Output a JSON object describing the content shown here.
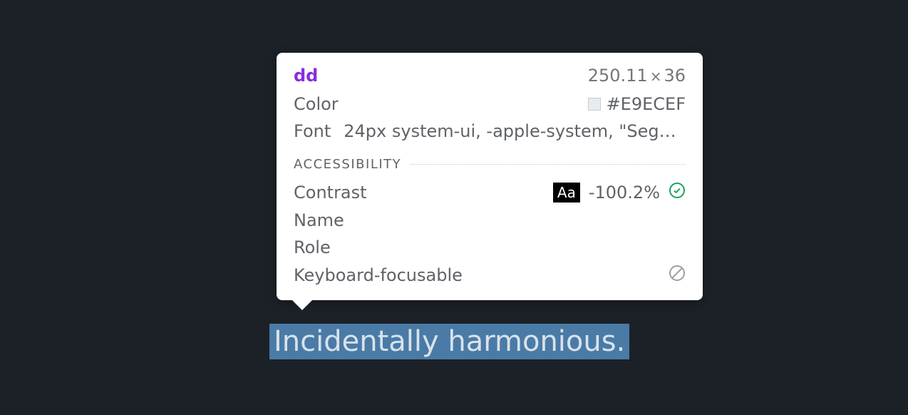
{
  "inspector": {
    "element_tag": "dd",
    "dimensions": {
      "width": "250.11",
      "height": "36"
    },
    "properties": {
      "color_label": "Color",
      "color_value": "#E9ECEF",
      "font_label": "Font",
      "font_value": "24px system-ui, -apple-system, \"Segoe…"
    },
    "accessibility": {
      "section_title": "ACCESSIBILITY",
      "contrast_label": "Contrast",
      "contrast_badge": "Aa",
      "contrast_value": "-100.2%",
      "name_label": "Name",
      "role_label": "Role",
      "keyboard_label": "Keyboard-focusable"
    }
  },
  "highlighted_text": "Incidentally harmonious."
}
